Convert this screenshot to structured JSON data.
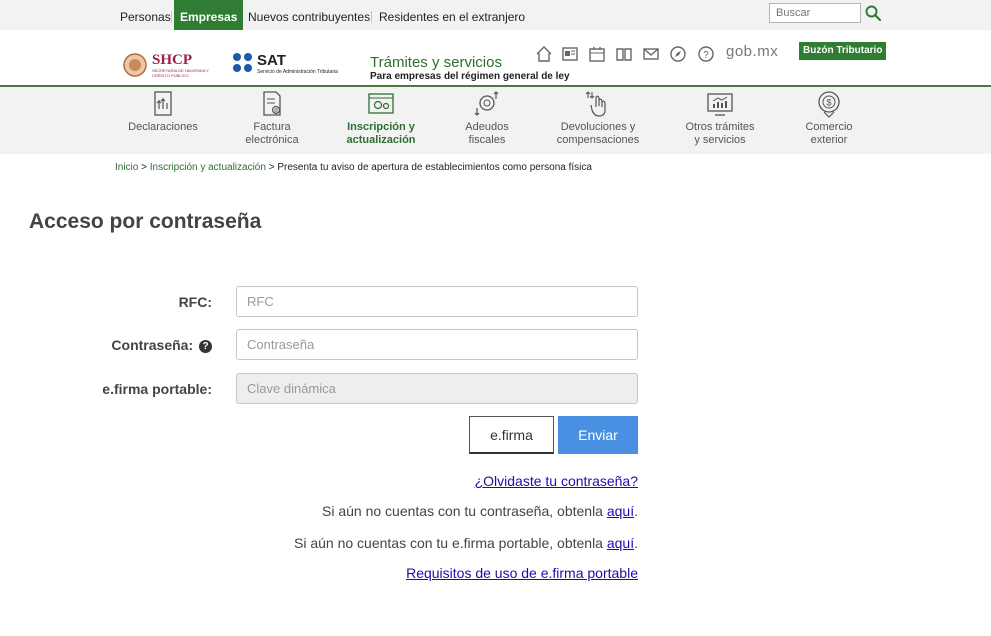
{
  "top_nav": {
    "items": [
      "Personas",
      "Empresas",
      "Nuevos contribuyentes",
      "Residentes en el extranjero"
    ],
    "active": "Empresas"
  },
  "search": {
    "placeholder": "Buscar"
  },
  "header": {
    "shcp_logo": "SHCP",
    "shcp_sub": "SECRETARÍA DE HACIENDA Y CRÉDITO PÚBLICO",
    "sat_logo": "SAT",
    "sat_sub": "Servicio de Administración Tributaria",
    "title": "Trámites y servicios",
    "subtitle": "Para empresas del régimen general de ley",
    "gob_mx": "gob.mx",
    "buzon": "Buzón Tributario",
    "icons": [
      "home-icon",
      "news-icon",
      "calendar-icon",
      "book-icon",
      "mail-icon",
      "compass-icon",
      "help-icon"
    ]
  },
  "nav": {
    "items": [
      {
        "line1": "Declaraciones",
        "line2": "",
        "icon": "declaraciones-icon"
      },
      {
        "line1": "Factura",
        "line2": "electrónica",
        "icon": "factura-icon"
      },
      {
        "line1": "Inscripción y",
        "line2": "actualización",
        "icon": "inscripcion-icon"
      },
      {
        "line1": "Adeudos",
        "line2": "fiscales",
        "icon": "adeudos-icon"
      },
      {
        "line1": "Devoluciones y",
        "line2": "compensaciones",
        "icon": "devoluciones-icon"
      },
      {
        "line1": "Otros trámites",
        "line2": "y servicios",
        "icon": "otros-tramites-icon"
      },
      {
        "line1": "Comercio",
        "line2": "exterior",
        "icon": "comercio-icon"
      }
    ],
    "active": "Inscripción y actualización"
  },
  "breadcrumb": {
    "home": "Inicio",
    "sep": ">",
    "section": "Inscripción y actualización",
    "current": "Presenta tu aviso de apertura de establecimientos como persona física"
  },
  "form": {
    "title": "Acceso por contraseña",
    "rfc_label": "RFC:",
    "rfc_placeholder": "RFC",
    "password_label": "Contraseña:",
    "password_help": "?",
    "password_placeholder": "Contraseña",
    "efirma_label": "e.firma portable:",
    "efirma_placeholder": "Clave dinámica",
    "efirma_button": "e.firma",
    "submit_button": "Enviar"
  },
  "links": {
    "forgot": "¿Olvidaste tu contraseña?",
    "no_password_text": "Si aún no cuentas con tu contraseña, obtenla ",
    "no_password_link": "aquí",
    "no_efirma_text": "Si aún no cuentas con tu e.firma portable, obtenla ",
    "no_efirma_link": "aquí",
    "period": ".",
    "requisitos": "Requisitos de uso de e.firma portable"
  },
  "colors": {
    "green": "#2e7d32",
    "blue_button": "#4a90e2",
    "link": "#1a0dab"
  }
}
